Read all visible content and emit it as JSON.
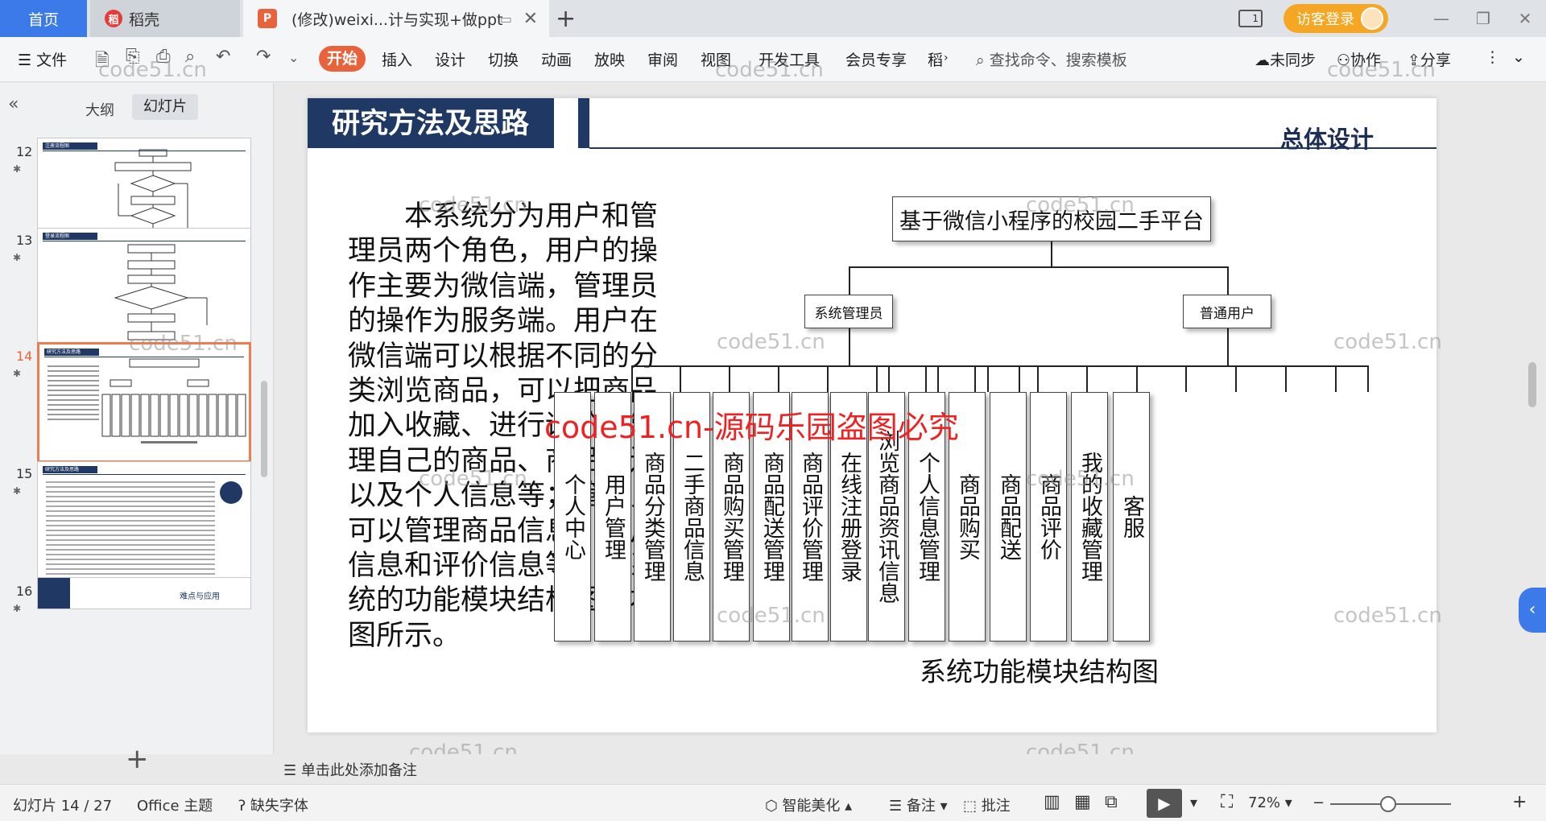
{
  "titlebar": {
    "tab_home": "首页",
    "tab_docer": "稻壳",
    "tab_doc": "(修改)weixi...计与实现+做ppt",
    "login": "访客登录"
  },
  "ribbon": {
    "file": "文件",
    "start": "开始",
    "menus": [
      "插入",
      "设计",
      "切换",
      "动画",
      "放映",
      "审阅",
      "视图",
      "开发工具",
      "会员专享",
      "稻"
    ],
    "search": "查找命令、搜索模板",
    "sync": "未同步",
    "collab": "协作",
    "share": "分享"
  },
  "leftpanel": {
    "tab_outline": "大纲",
    "tab_slides": "幻灯片",
    "thumbs": [
      {
        "num": "12",
        "title": "注册流程图"
      },
      {
        "num": "13",
        "title": "登录流程图"
      },
      {
        "num": "14",
        "title": "研究方法及思路"
      },
      {
        "num": "15",
        "title": "研究方法及思路"
      },
      {
        "num": "16",
        "title": "难点与应用"
      }
    ]
  },
  "slide": {
    "title": "研究方法及思路",
    "subtitle": "总体设计",
    "body": "本系统分为用户和管理员两个角色，用户的操作主要为微信端，管理员的操作为服务端。用户在微信端可以根据不同的分类浏览商品，可以把商品加入收藏、进行评价、管理自己的商品、商品配送以及个人信息等；管理员可以管理商品信息、用户信息和评价信息等。本系统的功能模块结构图如右图所示。",
    "chart": {
      "root": "基于微信小程序的校园二手平台",
      "admin": "系统管理员",
      "user": "普通用户",
      "admin_modules": [
        "个人中心",
        "用户管理",
        "商品分类管理",
        "二手商品信息",
        "商品购买管理",
        "商品配送管理",
        "商品评价管理"
      ],
      "user_modules": [
        "在线注册登录",
        "浏览商品资讯信息",
        "个人信息管理",
        "商品购买",
        "商品配送",
        "商品评价",
        "我的收藏管理",
        "客服"
      ],
      "caption": "系统功能模块结构图"
    }
  },
  "watermarks": {
    "grey": "code51.cn",
    "red": "code51.cn-源码乐园盗图必究"
  },
  "notes": "单击此处添加备注",
  "status": {
    "slide_pos": "幻灯片 14 / 27",
    "theme": "Office 主题",
    "missing_font": "缺失字体",
    "beautify": "智能美化",
    "notes_btn": "备注",
    "comment": "批注",
    "zoom": "72%"
  }
}
